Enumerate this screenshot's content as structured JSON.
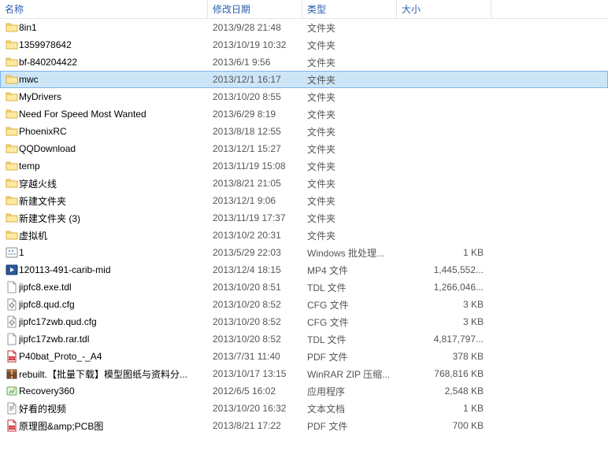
{
  "header": {
    "name": "名称",
    "date": "修改日期",
    "type": "类型",
    "size": "大小"
  },
  "icons": {
    "folder": "folder",
    "bat": "bat",
    "video": "video",
    "file": "file",
    "cfg": "cfg",
    "pdf": "pdf",
    "zip": "zip",
    "exe": "exe",
    "txt": "txt"
  },
  "rows": [
    {
      "icon": "folder",
      "name": "8in1",
      "date": "2013/9/28 21:48",
      "type": "文件夹",
      "size": "",
      "selected": false
    },
    {
      "icon": "folder",
      "name": "1359978642",
      "date": "2013/10/19 10:32",
      "type": "文件夹",
      "size": "",
      "selected": false
    },
    {
      "icon": "folder",
      "name": "bf-840204422",
      "date": "2013/6/1 9:56",
      "type": "文件夹",
      "size": "",
      "selected": false
    },
    {
      "icon": "folder",
      "name": "mwc",
      "date": "2013/12/1 16:17",
      "type": "文件夹",
      "size": "",
      "selected": true
    },
    {
      "icon": "folder",
      "name": "MyDrivers",
      "date": "2013/10/20 8:55",
      "type": "文件夹",
      "size": "",
      "selected": false
    },
    {
      "icon": "folder",
      "name": "Need For Speed Most Wanted",
      "date": "2013/6/29 8:19",
      "type": "文件夹",
      "size": "",
      "selected": false
    },
    {
      "icon": "folder",
      "name": "PhoenixRC",
      "date": "2013/8/18 12:55",
      "type": "文件夹",
      "size": "",
      "selected": false
    },
    {
      "icon": "folder",
      "name": "QQDownload",
      "date": "2013/12/1 15:27",
      "type": "文件夹",
      "size": "",
      "selected": false
    },
    {
      "icon": "folder",
      "name": "temp",
      "date": "2013/11/19 15:08",
      "type": "文件夹",
      "size": "",
      "selected": false
    },
    {
      "icon": "folder",
      "name": "穿越火线",
      "date": "2013/8/21 21:05",
      "type": "文件夹",
      "size": "",
      "selected": false
    },
    {
      "icon": "folder",
      "name": "新建文件夹",
      "date": "2013/12/1 9:06",
      "type": "文件夹",
      "size": "",
      "selected": false
    },
    {
      "icon": "folder",
      "name": "新建文件夹 (3)",
      "date": "2013/11/19 17:37",
      "type": "文件夹",
      "size": "",
      "selected": false
    },
    {
      "icon": "folder",
      "name": "虚拟机",
      "date": "2013/10/2 20:31",
      "type": "文件夹",
      "size": "",
      "selected": false
    },
    {
      "icon": "bat",
      "name": "1",
      "date": "2013/5/29 22:03",
      "type": "Windows 批处理...",
      "size": "1 KB",
      "selected": false
    },
    {
      "icon": "video",
      "name": "120113-491-carib-mid",
      "date": "2013/12/4 18:15",
      "type": "MP4 文件",
      "size": "1,445,552...",
      "selected": false
    },
    {
      "icon": "file",
      "name": "jipfc8.exe.tdl",
      "date": "2013/10/20 8:51",
      "type": "TDL 文件",
      "size": "1,266,046...",
      "selected": false
    },
    {
      "icon": "cfg",
      "name": "jipfc8.qud.cfg",
      "date": "2013/10/20 8:52",
      "type": "CFG 文件",
      "size": "3 KB",
      "selected": false
    },
    {
      "icon": "cfg",
      "name": "jipfc17zwb.qud.cfg",
      "date": "2013/10/20 8:52",
      "type": "CFG 文件",
      "size": "3 KB",
      "selected": false
    },
    {
      "icon": "file",
      "name": "jipfc17zwb.rar.tdl",
      "date": "2013/10/20 8:52",
      "type": "TDL 文件",
      "size": "4,817,797...",
      "selected": false
    },
    {
      "icon": "pdf",
      "name": "P40bat_Proto_-_A4",
      "date": "2013/7/31 11:40",
      "type": "PDF 文件",
      "size": "378 KB",
      "selected": false
    },
    {
      "icon": "zip",
      "name": "rebuilt.【批量下载】模型图纸与资料分...",
      "date": "2013/10/17 13:15",
      "type": "WinRAR ZIP 压缩...",
      "size": "768,816 KB",
      "selected": false
    },
    {
      "icon": "exe",
      "name": "Recovery360",
      "date": "2012/6/5 16:02",
      "type": "应用程序",
      "size": "2,548 KB",
      "selected": false
    },
    {
      "icon": "txt",
      "name": "好看的视频",
      "date": "2013/10/20 16:32",
      "type": "文本文档",
      "size": "1 KB",
      "selected": false
    },
    {
      "icon": "pdf",
      "name": "原理图&amp;PCB图",
      "date": "2013/8/21 17:22",
      "type": "PDF 文件",
      "size": "700 KB",
      "selected": false
    }
  ]
}
